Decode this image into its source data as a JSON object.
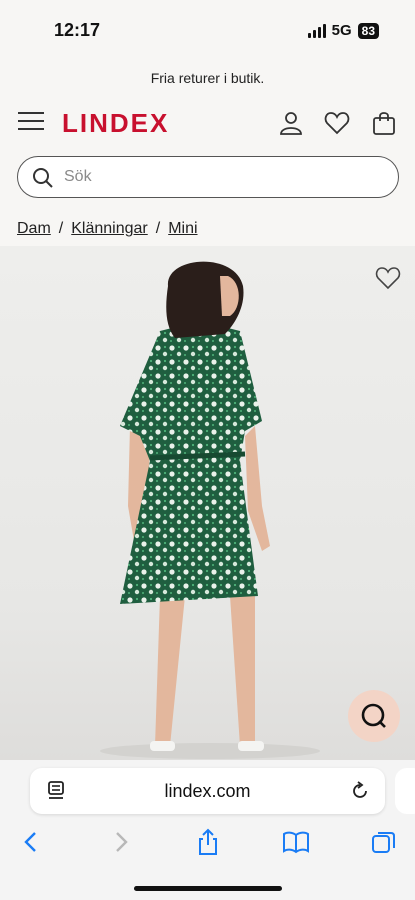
{
  "status_bar": {
    "time": "12:17",
    "network": "5G",
    "battery": "83"
  },
  "promo": {
    "text": "Fria returer i butik."
  },
  "header": {
    "logo": "LINDEX"
  },
  "search": {
    "placeholder": "Sök"
  },
  "breadcrumb": {
    "items": [
      "Dam",
      "Klänningar",
      "Mini"
    ],
    "separator": "/"
  },
  "browser": {
    "url": "lindex.com"
  },
  "colors": {
    "brand": "#c8102e",
    "chat_bubble": "#f3d4c6",
    "safari_blue": "#1a7cf5",
    "dress_green": "#1f5e3f"
  }
}
